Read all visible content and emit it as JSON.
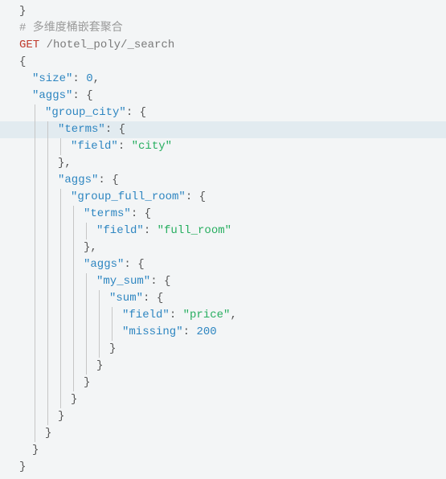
{
  "lines": [
    {
      "indents": [],
      "hl": false,
      "tokens": [
        {
          "t": "}",
          "c": "punc"
        }
      ]
    },
    {
      "indents": [],
      "hl": false,
      "tokens": [
        {
          "t": "# 多维度桶嵌套聚合",
          "c": "comment"
        }
      ]
    },
    {
      "indents": [],
      "hl": false,
      "tokens": [
        {
          "t": "GET",
          "c": "method"
        },
        {
          "t": " ",
          "c": "punc"
        },
        {
          "t": "/hotel_poly/_search",
          "c": "path"
        }
      ]
    },
    {
      "indents": [],
      "hl": false,
      "tokens": [
        {
          "t": "{",
          "c": "punc"
        }
      ]
    },
    {
      "indents": [
        false
      ],
      "hl": false,
      "tokens": [
        {
          "t": "\"size\"",
          "c": "key"
        },
        {
          "t": ": ",
          "c": "punc"
        },
        {
          "t": "0",
          "c": "number"
        },
        {
          "t": ",",
          "c": "punc"
        }
      ]
    },
    {
      "indents": [
        false
      ],
      "hl": false,
      "tokens": [
        {
          "t": "\"aggs\"",
          "c": "key"
        },
        {
          "t": ": {",
          "c": "punc"
        }
      ]
    },
    {
      "indents": [
        false,
        true
      ],
      "hl": false,
      "tokens": [
        {
          "t": "\"group_city\"",
          "c": "key"
        },
        {
          "t": ": {",
          "c": "punc"
        }
      ]
    },
    {
      "indents": [
        false,
        true,
        true
      ],
      "hl": true,
      "tokens": [
        {
          "t": "\"terms\"",
          "c": "key"
        },
        {
          "t": ": {",
          "c": "punc"
        }
      ]
    },
    {
      "indents": [
        false,
        true,
        true,
        true
      ],
      "hl": false,
      "tokens": [
        {
          "t": "\"field\"",
          "c": "key"
        },
        {
          "t": ": ",
          "c": "punc"
        },
        {
          "t": "\"city\"",
          "c": "string"
        }
      ]
    },
    {
      "indents": [
        false,
        true,
        true
      ],
      "hl": false,
      "tokens": [
        {
          "t": "},",
          "c": "punc"
        }
      ]
    },
    {
      "indents": [
        false,
        true,
        true
      ],
      "hl": false,
      "tokens": [
        {
          "t": "\"aggs\"",
          "c": "key"
        },
        {
          "t": ": {",
          "c": "punc"
        }
      ]
    },
    {
      "indents": [
        false,
        true,
        true,
        true
      ],
      "hl": false,
      "tokens": [
        {
          "t": "\"group_full_room\"",
          "c": "key"
        },
        {
          "t": ": {",
          "c": "punc"
        }
      ]
    },
    {
      "indents": [
        false,
        true,
        true,
        true,
        true
      ],
      "hl": false,
      "tokens": [
        {
          "t": "\"terms\"",
          "c": "key"
        },
        {
          "t": ": {",
          "c": "punc"
        }
      ]
    },
    {
      "indents": [
        false,
        true,
        true,
        true,
        true,
        true
      ],
      "hl": false,
      "tokens": [
        {
          "t": "\"field\"",
          "c": "key"
        },
        {
          "t": ": ",
          "c": "punc"
        },
        {
          "t": "\"full_room\"",
          "c": "string"
        }
      ]
    },
    {
      "indents": [
        false,
        true,
        true,
        true,
        true
      ],
      "hl": false,
      "tokens": [
        {
          "t": "},",
          "c": "punc"
        }
      ]
    },
    {
      "indents": [
        false,
        true,
        true,
        true,
        true
      ],
      "hl": false,
      "tokens": [
        {
          "t": "\"aggs\"",
          "c": "key"
        },
        {
          "t": ": {",
          "c": "punc"
        }
      ]
    },
    {
      "indents": [
        false,
        true,
        true,
        true,
        true,
        true
      ],
      "hl": false,
      "tokens": [
        {
          "t": "\"my_sum\"",
          "c": "key"
        },
        {
          "t": ": {",
          "c": "punc"
        }
      ]
    },
    {
      "indents": [
        false,
        true,
        true,
        true,
        true,
        true,
        true
      ],
      "hl": false,
      "tokens": [
        {
          "t": "\"sum\"",
          "c": "key"
        },
        {
          "t": ": {",
          "c": "punc"
        }
      ]
    },
    {
      "indents": [
        false,
        true,
        true,
        true,
        true,
        true,
        true,
        true
      ],
      "hl": false,
      "tokens": [
        {
          "t": "\"field\"",
          "c": "key"
        },
        {
          "t": ": ",
          "c": "punc"
        },
        {
          "t": "\"price\"",
          "c": "string"
        },
        {
          "t": ",",
          "c": "punc"
        }
      ]
    },
    {
      "indents": [
        false,
        true,
        true,
        true,
        true,
        true,
        true,
        true
      ],
      "hl": false,
      "tokens": [
        {
          "t": "\"missing\"",
          "c": "key"
        },
        {
          "t": ": ",
          "c": "punc"
        },
        {
          "t": "200",
          "c": "number"
        }
      ]
    },
    {
      "indents": [
        false,
        true,
        true,
        true,
        true,
        true,
        true
      ],
      "hl": false,
      "tokens": [
        {
          "t": "}",
          "c": "punc"
        }
      ]
    },
    {
      "indents": [
        false,
        true,
        true,
        true,
        true,
        true
      ],
      "hl": false,
      "tokens": [
        {
          "t": "}",
          "c": "punc"
        }
      ]
    },
    {
      "indents": [
        false,
        true,
        true,
        true,
        true
      ],
      "hl": false,
      "tokens": [
        {
          "t": "}",
          "c": "punc"
        }
      ]
    },
    {
      "indents": [
        false,
        true,
        true,
        true
      ],
      "hl": false,
      "tokens": [
        {
          "t": "}",
          "c": "punc"
        }
      ]
    },
    {
      "indents": [
        false,
        true,
        true
      ],
      "hl": false,
      "tokens": [
        {
          "t": "}",
          "c": "punc"
        }
      ]
    },
    {
      "indents": [
        false,
        true
      ],
      "hl": false,
      "tokens": [
        {
          "t": "}",
          "c": "punc"
        }
      ]
    },
    {
      "indents": [
        false
      ],
      "hl": false,
      "tokens": [
        {
          "t": "}",
          "c": "punc"
        }
      ]
    },
    {
      "indents": [],
      "hl": false,
      "tokens": [
        {
          "t": "}",
          "c": "punc"
        }
      ]
    }
  ]
}
